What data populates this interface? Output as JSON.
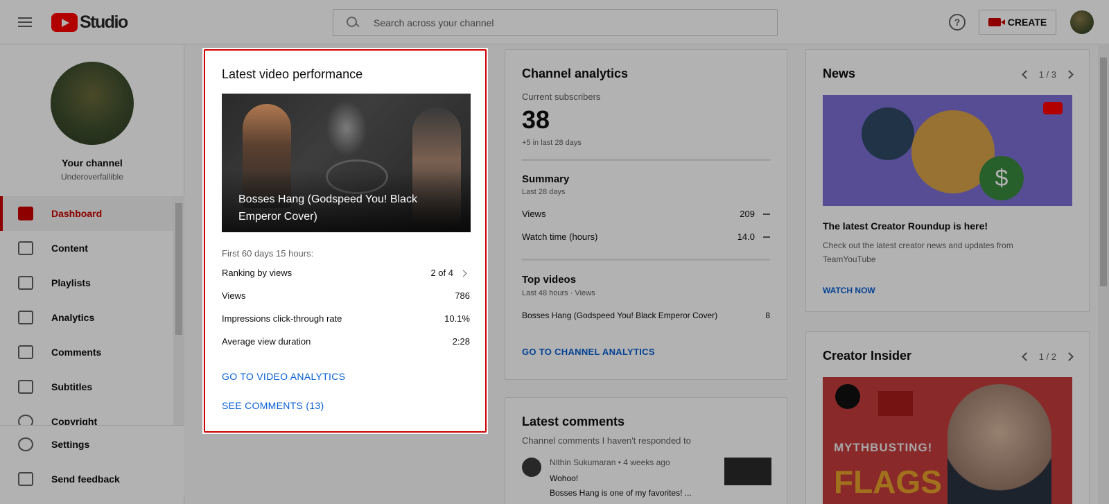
{
  "header": {
    "logo_text": "Studio",
    "search_placeholder": "Search across your channel",
    "help_glyph": "?",
    "create_label": "CREATE"
  },
  "sidebar": {
    "channel_title": "Your channel",
    "channel_name": "Underoverfallible",
    "items": [
      {
        "label": "Dashboard",
        "icon": "dashboard-icon",
        "active": true
      },
      {
        "label": "Content",
        "icon": "content-icon"
      },
      {
        "label": "Playlists",
        "icon": "playlists-icon"
      },
      {
        "label": "Analytics",
        "icon": "analytics-icon"
      },
      {
        "label": "Comments",
        "icon": "comments-icon"
      },
      {
        "label": "Subtitles",
        "icon": "subtitles-icon"
      },
      {
        "label": "Copyright",
        "icon": "copyright-icon"
      }
    ],
    "bottom_items": [
      {
        "label": "Settings",
        "icon": "gear-icon"
      },
      {
        "label": "Send feedback",
        "icon": "feedback-icon"
      }
    ]
  },
  "latest_video": {
    "title": "Latest video performance",
    "video_title": "Bosses Hang (Godspeed You! Black Emperor Cover)",
    "period": "First 60 days 15 hours:",
    "stats": [
      {
        "label": "Ranking by views",
        "value": "2 of 4"
      },
      {
        "label": "Views",
        "value": "786"
      },
      {
        "label": "Impressions click-through rate",
        "value": "10.1%"
      },
      {
        "label": "Average view duration",
        "value": "2:28"
      }
    ],
    "analytics_link": "GO TO VIDEO ANALYTICS",
    "comments_link": "SEE COMMENTS (13)"
  },
  "channel_analytics": {
    "title": "Channel analytics",
    "subs_label": "Current subscribers",
    "subs_value": "38",
    "subs_delta": "+5 in last 28 days",
    "summary_title": "Summary",
    "summary_period": "Last 28 days",
    "summary_rows": [
      {
        "label": "Views",
        "value": "209"
      },
      {
        "label": "Watch time (hours)",
        "value": "14.0"
      }
    ],
    "top_title": "Top videos",
    "top_period": "Last 48 hours · Views",
    "top_video": {
      "label": "Bosses Hang (Godspeed You! Black Emperor Cover)",
      "value": "8"
    },
    "link": "GO TO CHANNEL ANALYTICS"
  },
  "latest_comments": {
    "title": "Latest comments",
    "subtitle": "Channel comments I haven't responded to",
    "meta": "Nithin Sukumaran • 4 weeks ago",
    "line1": "Wohoo!",
    "line2": "Bosses Hang is one of my favorites! ..."
  },
  "news": {
    "title": "News",
    "pager": "1 / 3",
    "headline": "The latest Creator Roundup is here!",
    "body": "Check out the latest creator news and updates from TeamYouTube",
    "link": "WATCH NOW"
  },
  "creator_insider": {
    "title": "Creator Insider",
    "pager": "1 / 2",
    "thumb_text1": "MYTHBUSTING!",
    "thumb_text2": "FLAGS"
  }
}
